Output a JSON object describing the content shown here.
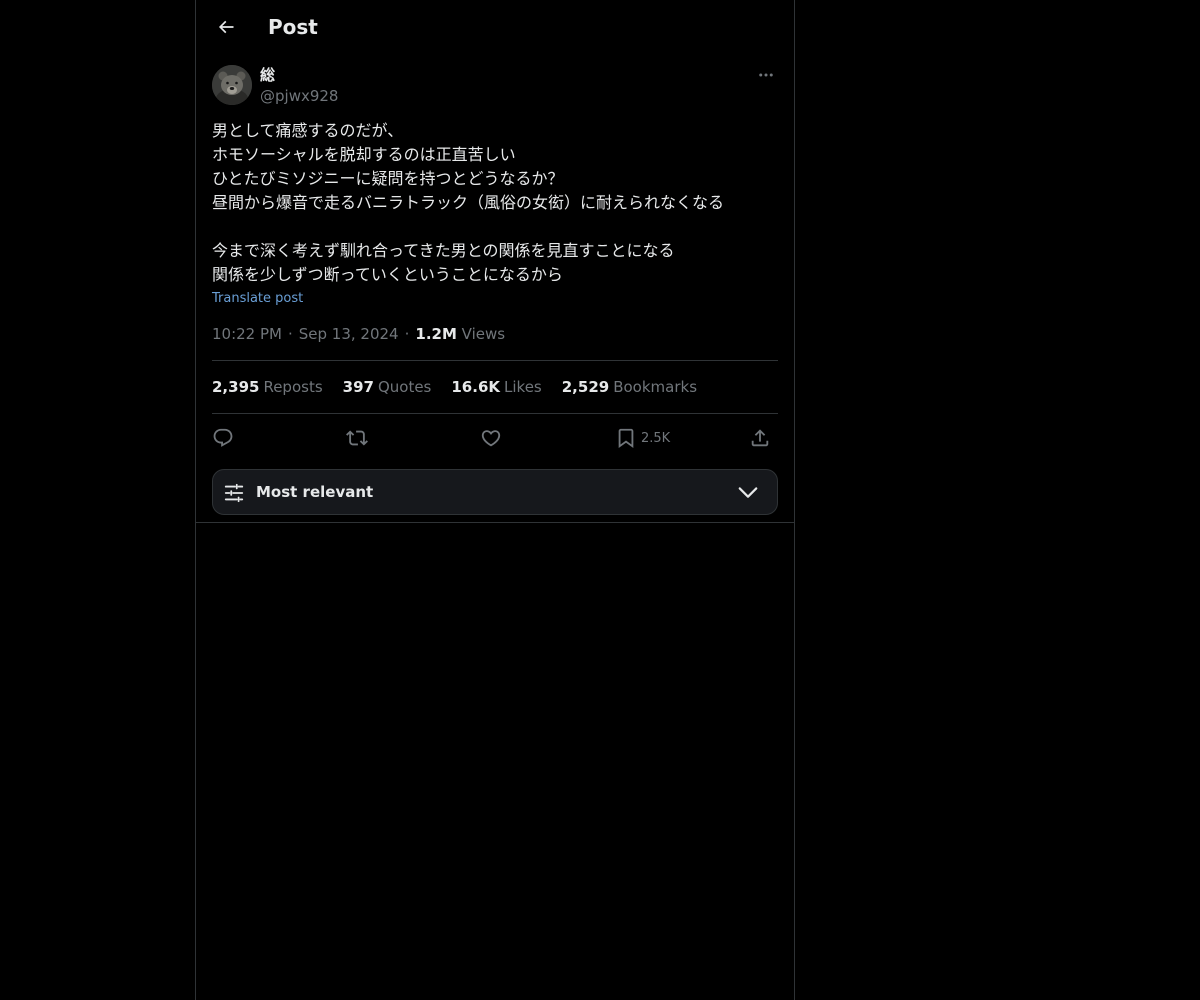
{
  "header": {
    "back_icon": "arrow-left-icon",
    "title": "Post"
  },
  "author": {
    "display_name": "総",
    "handle": "@pjwx928",
    "avatar_icon": "bear-avatar",
    "more_icon": "more-horizontal-icon"
  },
  "post": {
    "text": "男として痛感するのだが、\nホモソーシャルを脱却するのは正直苦しい\nひとたびミソジニーに疑問を持つとどうなるか？\n昼間から爆音で走るバニラトラック（風俗の女衒）に耐えられなくなる\n\n今まで深く考えず馴れ合ってきた男との関係を見直すことになる\n関係を少しずつ断っていくということになるから",
    "translate_label": "Translate post",
    "time": "10:22 PM",
    "date": "Sep 13, 2024",
    "separator": "·",
    "views_count": "1.2M",
    "views_label": "Views"
  },
  "stats": {
    "reposts_count": "2,395",
    "reposts_label": "Reposts",
    "quotes_count": "397",
    "quotes_label": "Quotes",
    "likes_count": "16.6K",
    "likes_label": "Likes",
    "bookmarks_count": "2,529",
    "bookmarks_label": "Bookmarks"
  },
  "actions": {
    "reply_icon": "reply-icon",
    "repost_icon": "repost-icon",
    "like_icon": "heart-icon",
    "bookmark_icon": "bookmark-icon",
    "bookmark_count": "2.5K",
    "share_icon": "share-icon"
  },
  "sort": {
    "label": "Most relevant",
    "icon": "sliders-icon",
    "chevron": "chevron-down-icon"
  },
  "colors": {
    "background": "#000000",
    "text": "#e7e9ea",
    "muted": "#71767b",
    "link": "#1d9bf0",
    "border": "#2f3336"
  }
}
